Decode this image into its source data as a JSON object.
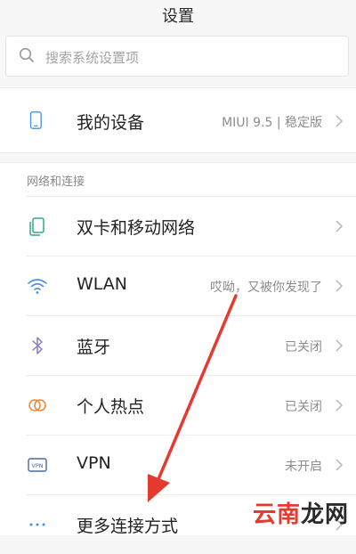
{
  "header": {
    "title": "设置"
  },
  "search": {
    "placeholder": "搜索系统设置项",
    "icon": "search-icon"
  },
  "device": {
    "label": "我的设备",
    "value": "MIUI 9.5 | 稳定版",
    "icon": "phone-icon"
  },
  "network": {
    "section_title": "网络和连接",
    "items": [
      {
        "label": "双卡和移动网络",
        "value": "",
        "icon": "dual-sim-icon"
      },
      {
        "label": "WLAN",
        "value": "哎呦，又被你发现了",
        "icon": "wifi-icon"
      },
      {
        "label": "蓝牙",
        "value": "已关闭",
        "icon": "bluetooth-icon"
      },
      {
        "label": "个人热点",
        "value": "已关闭",
        "icon": "hotspot-icon"
      },
      {
        "label": "VPN",
        "value": "未开启",
        "icon": "vpn-icon"
      },
      {
        "label": "更多连接方式",
        "value": "",
        "icon": "more-icon"
      }
    ]
  },
  "watermark": {
    "part1": "云南",
    "part2": "龙网"
  },
  "colors": {
    "accent_blue": "#4a90e2",
    "annotation_red": "#e53b2f",
    "bg": "#f7f7f7"
  }
}
